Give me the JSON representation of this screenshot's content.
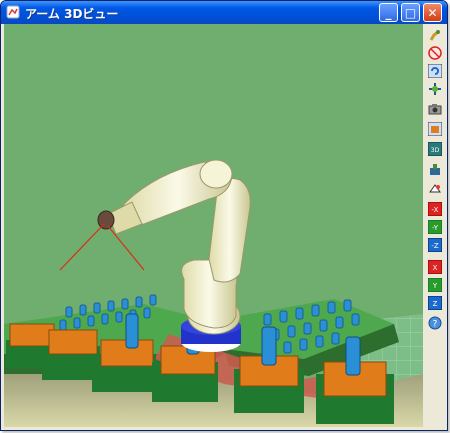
{
  "window": {
    "title": "アーム 3Dビュー",
    "controls": {
      "minimize": "_",
      "maximize": "□",
      "close": "✕"
    }
  },
  "viewport": {
    "background": "#6fae6f",
    "robot_color": "#f1efc6",
    "base_color": "#2233cc",
    "laser_color": "#dd2a1a"
  },
  "toolbar": {
    "icons": [
      "robot-arm-icon",
      "stop-icon",
      "rotate-view-icon",
      "move-view-icon",
      "camera-icon",
      "workpiece-icon",
      "3d-view-icon",
      "tool-icon",
      "reset-view-icon",
      "minus-x-icon",
      "minus-y-icon",
      "minus-z-icon",
      "plus-x-icon",
      "plus-y-icon",
      "plus-z-icon",
      "help-icon"
    ]
  }
}
